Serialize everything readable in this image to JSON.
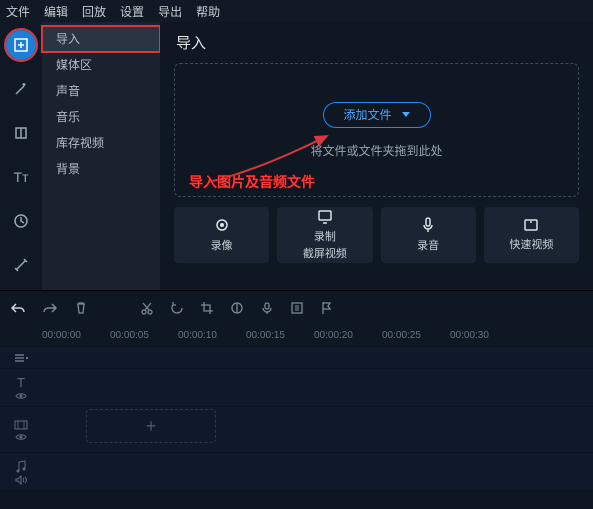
{
  "menu": {
    "file": "文件",
    "edit": "编辑",
    "playback": "回放",
    "settings": "设置",
    "export": "导出",
    "help": "帮助"
  },
  "tools": {
    "import": "import-icon",
    "magic": "magic-wand-icon",
    "crop": "crop-icon",
    "text": "text-icon",
    "time": "clock-icon",
    "toolbox": "tools-icon"
  },
  "sidebar": {
    "items": [
      {
        "label": "导入"
      },
      {
        "label": "媒体区"
      },
      {
        "label": "声音"
      },
      {
        "label": "音乐"
      },
      {
        "label": "库存视频"
      },
      {
        "label": "背景"
      }
    ]
  },
  "content": {
    "title": "导入",
    "add_files": "添加文件",
    "drop_hint": "将文件或文件夹拖到此处",
    "annotation": "导入图片及音频文件"
  },
  "cards": {
    "record_camera": "录像",
    "record_screen_l1": "录制",
    "record_screen_l2": "截屏视频",
    "record_audio": "录音",
    "quick_video": "快速视频"
  },
  "ruler": {
    "marks": [
      "00:00:00",
      "00:00:05",
      "00:00:10",
      "00:00:15",
      "00:00:20",
      "00:00:25",
      "00:00:30"
    ]
  },
  "timeline_add": "+"
}
